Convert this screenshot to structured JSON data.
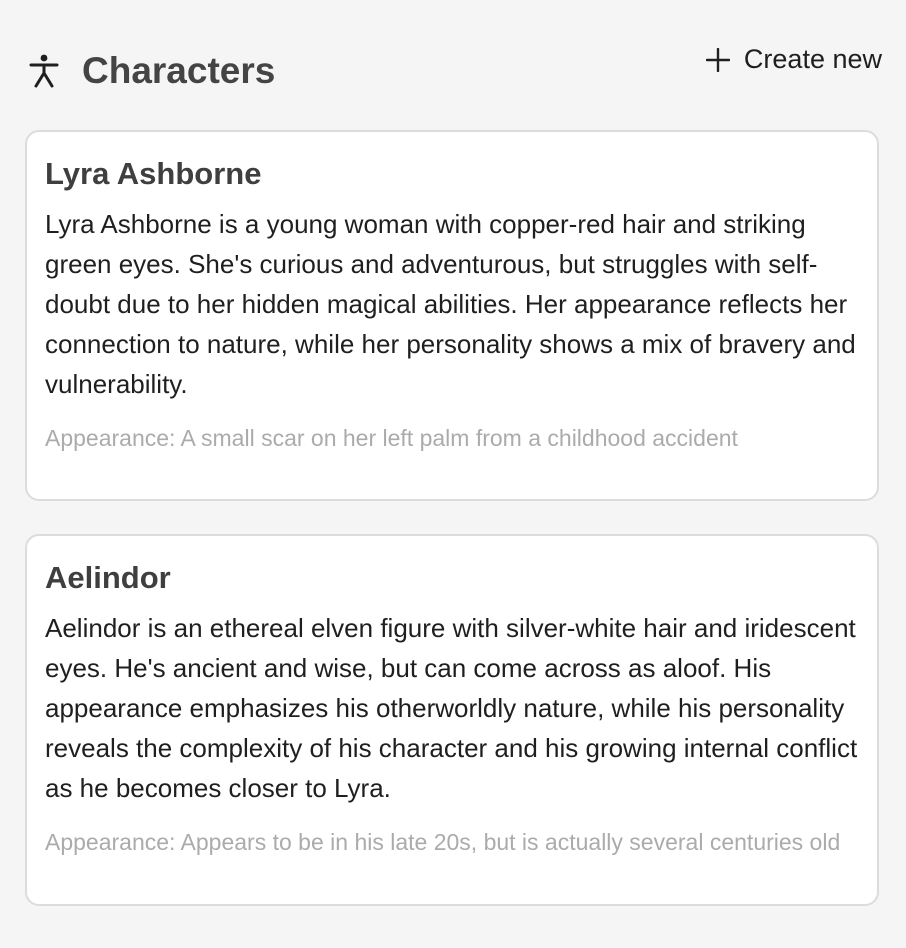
{
  "header": {
    "icon": "person-icon",
    "title": "Characters",
    "create_icon": "plus-icon",
    "create_label": "Create new"
  },
  "characters": [
    {
      "name": "Lyra Ashborne",
      "description": "Lyra Ashborne is a young woman with copper-red hair and striking green eyes. She's curious and adventurous, but struggles with self-doubt due to her hidden magical abilities. Her appearance reflects her connection to nature, while her personality shows a mix of bravery and vulnerability.",
      "appearance": "Appearance: A small scar on her left palm from a childhood accident"
    },
    {
      "name": "Aelindor",
      "description": "Aelindor is an ethereal elven figure with silver-white hair and iridescent eyes. He's ancient and wise, but can come across as aloof. His appearance emphasizes his otherworldly nature, while his personality reveals the complexity of his character and his growing internal conflict as he becomes closer to Lyra.",
      "appearance": "Appearance: Appears to be in his late 20s, but is actually several centuries old"
    }
  ],
  "colors": {
    "background": "#f5f5f5",
    "card_border": "#dcdcdc",
    "muted_text": "#ababab"
  }
}
